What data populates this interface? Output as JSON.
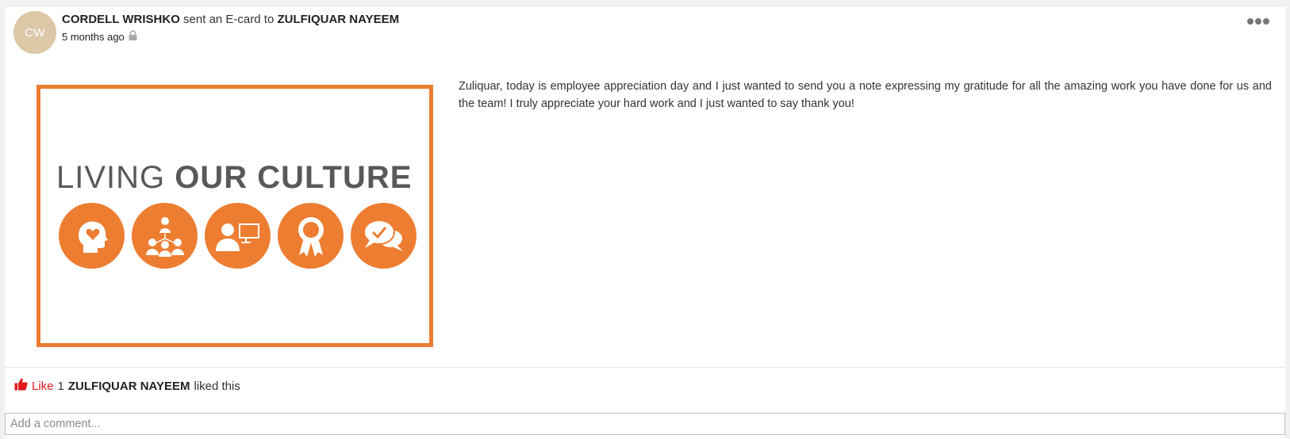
{
  "post": {
    "avatar_initials": "CW",
    "sender": "CORDELL WRISHKO",
    "action_text": " sent an E-card to ",
    "recipient": "ZULFIQUAR NAYEEM",
    "time_ago": "5 months ago",
    "privacy_icon": "lock-icon",
    "more_icon": "ellipsis-icon",
    "message": "Zuliquar, today is employee appreciation day and I just wanted to send you a note expressing my gratitude for all the amazing work you have done for us and the team!  I truly appreciate your hard work and I just wanted to say thank you!"
  },
  "ecard": {
    "title_light": "LIVING ",
    "title_bold": "OUR CULTURE",
    "border_color": "#ed7d31",
    "icons": [
      "head-heart-icon",
      "team-network-icon",
      "person-computer-icon",
      "award-ribbon-icon",
      "chat-check-icon"
    ]
  },
  "likes": {
    "like_label": "Like",
    "count": "1",
    "liker": "ZULFIQUAR NAYEEM",
    "suffix": "liked this",
    "like_color": "#e0191a"
  },
  "comment": {
    "placeholder": "Add a comment..."
  }
}
